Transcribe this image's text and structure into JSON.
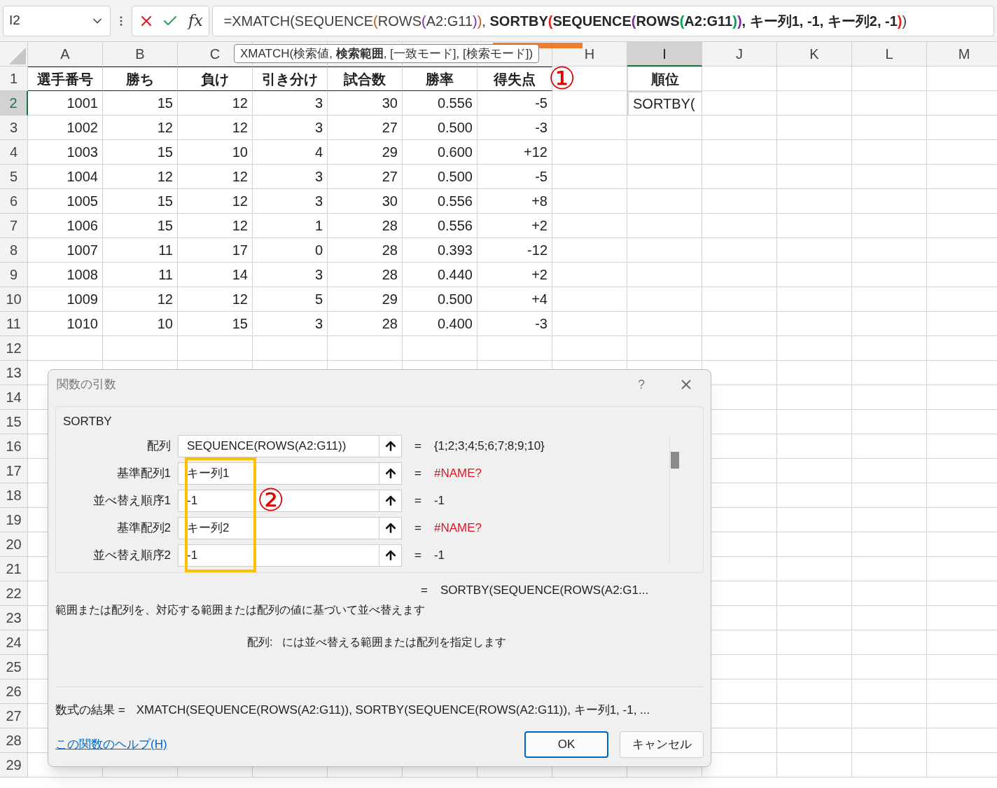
{
  "name_box": {
    "value": "I2"
  },
  "formula_bar": {
    "fx_label": "fx",
    "segments": [
      {
        "text": "=XMATCH(SEQUENCE",
        "color": "#404040",
        "bold": false
      },
      {
        "text": "(",
        "color": "#c55a11",
        "bold": false
      },
      {
        "text": "ROWS",
        "color": "#404040",
        "bold": false
      },
      {
        "text": "(",
        "color": "#7030a0",
        "bold": false
      },
      {
        "text": "A2:G11",
        "color": "#404040",
        "bold": false
      },
      {
        "text": ")",
        "color": "#7030a0",
        "bold": false
      },
      {
        "text": ")",
        "color": "#c55a11",
        "bold": false
      },
      {
        "text": ", ",
        "color": "#404040",
        "bold": false
      },
      {
        "text": "SORTBY",
        "color": "#262626",
        "bold": true
      },
      {
        "text": "(",
        "color": "#e0201b",
        "bold": true
      },
      {
        "text": "SEQUENCE",
        "color": "#262626",
        "bold": true
      },
      {
        "text": "(",
        "color": "#7030a0",
        "bold": true
      },
      {
        "text": "ROWS",
        "color": "#262626",
        "bold": true
      },
      {
        "text": "(",
        "color": "#00a050",
        "bold": true
      },
      {
        "text": "A2:G11",
        "color": "#262626",
        "bold": true
      },
      {
        "text": ")",
        "color": "#00a050",
        "bold": true
      },
      {
        "text": ")",
        "color": "#7030a0",
        "bold": true
      },
      {
        "text": ", キー列1, -1, キー列2, -1",
        "color": "#262626",
        "bold": true
      },
      {
        "text": ")",
        "color": "#e0201b",
        "bold": true
      },
      {
        "text": ")",
        "color": "#404040",
        "bold": false
      }
    ]
  },
  "tooltip": {
    "text": "XMATCH(検索値, **検索範囲**, [一致モード], [検索モード])"
  },
  "grid": {
    "columns": [
      {
        "label": "A",
        "selected": false
      },
      {
        "label": "B",
        "selected": false
      },
      {
        "label": "C",
        "selected": false
      },
      {
        "selected": false
      },
      {
        "selected": false
      },
      {
        "selected": false
      },
      {
        "selected": false
      },
      {
        "label": "H",
        "selected": false
      },
      {
        "label": "I",
        "selected": true
      },
      {
        "label": "J",
        "selected": false
      },
      {
        "label": "K",
        "selected": false
      },
      {
        "label": "L",
        "selected": false
      },
      {
        "label": "M",
        "selected": false
      }
    ],
    "row_headers": [
      {
        "label": "1",
        "selected": false
      },
      {
        "label": "2",
        "selected": true
      },
      {
        "label": "3",
        "selected": false
      },
      {
        "label": "4",
        "selected": false
      },
      {
        "label": "5",
        "selected": false
      },
      {
        "label": "6",
        "selected": false
      },
      {
        "label": "7",
        "selected": false
      },
      {
        "label": "8",
        "selected": false
      },
      {
        "label": "9",
        "selected": false
      },
      {
        "label": "10",
        "selected": false
      },
      {
        "label": "11",
        "selected": false
      },
      {
        "label": "12",
        "selected": false
      },
      {
        "label": "13",
        "selected": false
      },
      {
        "label": "14",
        "selected": false
      },
      {
        "label": "15",
        "selected": false
      },
      {
        "label": "16",
        "selected": false
      },
      {
        "label": "17",
        "selected": false
      },
      {
        "label": "18",
        "selected": false
      },
      {
        "label": "19",
        "selected": false
      },
      {
        "label": "20",
        "selected": false
      },
      {
        "label": "21",
        "selected": false
      },
      {
        "label": "22",
        "selected": false
      },
      {
        "label": "23",
        "selected": false
      },
      {
        "label": "24",
        "selected": false
      },
      {
        "label": "25",
        "selected": false
      },
      {
        "label": "26",
        "selected": false
      },
      {
        "label": "27",
        "selected": false
      },
      {
        "label": "28",
        "selected": false
      },
      {
        "label": "29",
        "selected": false
      }
    ],
    "table": {
      "header": [
        "選手番号",
        "勝ち",
        "負け",
        "引き分け",
        "試合数",
        "勝率",
        "得失点"
      ],
      "rows": [
        [
          "1001",
          "15",
          "12",
          "3",
          "30",
          "0.556",
          "-5"
        ],
        [
          "1002",
          "12",
          "12",
          "3",
          "27",
          "0.500",
          "-3"
        ],
        [
          "1003",
          "15",
          "10",
          "4",
          "29",
          "0.600",
          "+12"
        ],
        [
          "1004",
          "12",
          "12",
          "3",
          "27",
          "0.500",
          "-5"
        ],
        [
          "1005",
          "15",
          "12",
          "3",
          "30",
          "0.556",
          "+8"
        ],
        [
          "1006",
          "15",
          "12",
          "1",
          "28",
          "0.556",
          "+2"
        ],
        [
          "1007",
          "11",
          "17",
          "0",
          "28",
          "0.393",
          "-12"
        ],
        [
          "1008",
          "11",
          "14",
          "3",
          "28",
          "0.440",
          "+2"
        ],
        [
          "1009",
          "12",
          "12",
          "5",
          "29",
          "0.500",
          "+4"
        ],
        [
          "1010",
          "10",
          "15",
          "3",
          "28",
          "0.400",
          "-3"
        ]
      ]
    },
    "rank": {
      "header": "順位",
      "active_value": "SORTBY("
    },
    "annotation": "①"
  },
  "dialog": {
    "title": "関数の引数",
    "help": "?",
    "function_name": "SORTBY",
    "args": [
      {
        "label": "配列",
        "value": "SEQUENCE(ROWS(A2:G11))",
        "result": "{1;2;3;4;5;6;7;8;9;10}",
        "error": false
      },
      {
        "label": "基準配列1",
        "value": "キー列1",
        "result": "#NAME?",
        "error": true
      },
      {
        "label": "並べ替え順序1",
        "value": "-1",
        "result": "-1",
        "error": false
      },
      {
        "label": "基準配列2",
        "value": "キー列2",
        "result": "#NAME?",
        "error": true
      },
      {
        "label": "並べ替え順序2",
        "value": "-1",
        "result": "-1",
        "error": false
      }
    ],
    "equals": "=",
    "total_result": "SORTBY(SEQUENCE(ROWS(A2:G1...",
    "description": "範囲または配列を、対応する範囲または配列の値に基づいて並べ替えます",
    "arg_help": {
      "name": "配列:",
      "text": "には並べ替える範囲または配列を指定します"
    },
    "formula_result": {
      "label": "数式の結果 =",
      "value": "XMATCH(SEQUENCE(ROWS(A2:G11)), SORTBY(SEQUENCE(ROWS(A2:G11)), キー列1, -1, ..."
    },
    "help_link": "この関数のヘルプ(H)",
    "buttons": [
      {
        "label": "OK",
        "default": true
      },
      {
        "label": "キャンセル",
        "default": false
      }
    ],
    "annotation": "②"
  }
}
